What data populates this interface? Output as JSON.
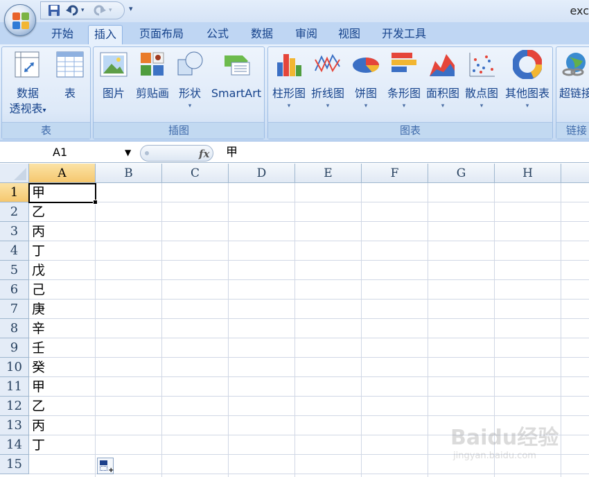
{
  "title": "exc",
  "tabs": [
    {
      "label": "开始"
    },
    {
      "label": "插入"
    },
    {
      "label": "页面布局"
    },
    {
      "label": "公式"
    },
    {
      "label": "数据"
    },
    {
      "label": "审阅"
    },
    {
      "label": "视图"
    },
    {
      "label": "开发工具"
    }
  ],
  "active_tab": "插入",
  "ribbon": {
    "groups": {
      "table": {
        "label": "表",
        "pivot_line1": "数据",
        "pivot_line2": "透视表",
        "pivot_arrow": "▾",
        "table_label": "表"
      },
      "illustrations": {
        "label": "插图",
        "picture": "图片",
        "clipart": "剪贴画",
        "shapes": "形状",
        "smartart": "SmartArt"
      },
      "charts": {
        "label": "图表",
        "column": "柱形图",
        "line": "折线图",
        "pie": "饼图",
        "bar": "条形图",
        "area": "面积图",
        "scatter": "散点图",
        "other": "其他图表"
      },
      "links": {
        "label": "链接",
        "hyperlink": "超链接"
      }
    }
  },
  "formula_bar": {
    "name_box": "A1",
    "fx": "fx",
    "value": "甲"
  },
  "columns": [
    "A",
    "B",
    "C",
    "D",
    "E",
    "F",
    "G",
    "H"
  ],
  "rows": [
    "1",
    "2",
    "3",
    "4",
    "5",
    "6",
    "7",
    "8",
    "9",
    "10",
    "11",
    "12",
    "13",
    "14",
    "15"
  ],
  "cells_a": [
    "甲",
    "乙",
    "丙",
    "丁",
    "戊",
    "己",
    "庚",
    "辛",
    "壬",
    "癸",
    "甲",
    "乙",
    "丙",
    "丁"
  ],
  "watermark": {
    "brand": "Baidu经验",
    "url": "jingyan.baidu.com"
  }
}
